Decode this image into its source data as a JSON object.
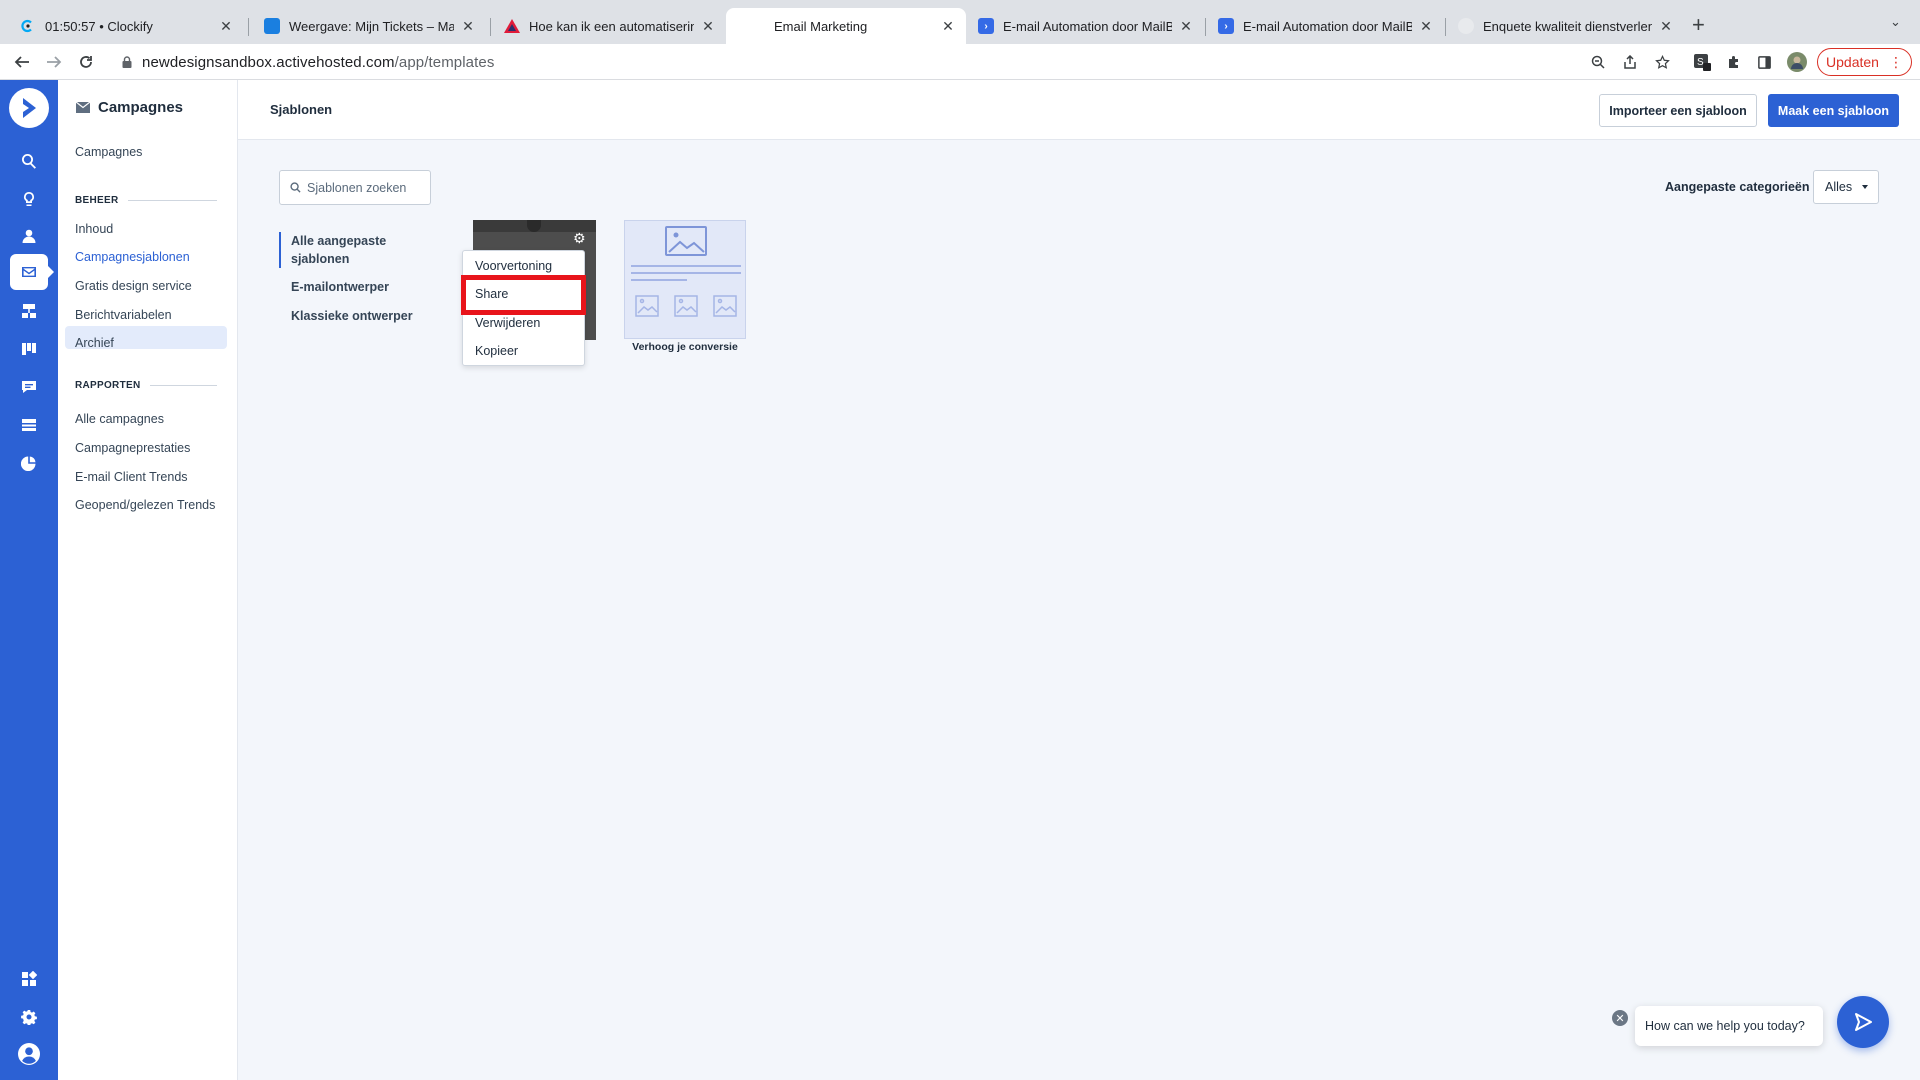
{
  "browser": {
    "tabs": [
      {
        "title": "01:50:57 • Clockify",
        "favicon": "clockify-icon",
        "color": "#03a9f4"
      },
      {
        "title": "Weergave: Mijn Tickets – MailBlue",
        "favicon": "mailblue-icon",
        "color": "#1a7fe0"
      },
      {
        "title": "Hoe kan ik een automatisering",
        "favicon": "triangle-icon",
        "color": "#e01b3a"
      },
      {
        "title": "Email Marketing",
        "favicon": "",
        "color": ""
      },
      {
        "title": "E-mail Automation door MailBlue",
        "favicon": "activecampaign-icon",
        "color": "#356ae6"
      },
      {
        "title": "E-mail Automation door MailBlue",
        "favicon": "activecampaign-icon",
        "color": "#356ae6"
      },
      {
        "title": "Enquete kwaliteit dienstverlening",
        "favicon": "globe-icon",
        "color": "#9aa0a6"
      }
    ],
    "url_host": "newdesignsandbox.activehosted.com",
    "url_path": "/app/templates",
    "update_label": "Updaten"
  },
  "subnav": {
    "title": "Campagnes",
    "top_link": "Campagnes",
    "section_beheer": "BEHEER",
    "beheer_items": [
      "Inhoud",
      "Campagnesjablonen",
      "Gratis design service",
      "Berichtvariabelen",
      "Archief"
    ],
    "section_rapporten": "RAPPORTEN",
    "rapporten_items": [
      "Alle campagnes",
      "Campagneprestaties",
      "E-mail Client Trends",
      "Geopend/gelezen Trends"
    ]
  },
  "header": {
    "title": "Sjablonen",
    "import_label": "Importeer een sjabloon",
    "create_label": "Maak een sjabloon"
  },
  "content": {
    "search_placeholder": "Sjablonen zoeken",
    "category_label": "Aangepaste categorieën",
    "category_value": "Alles",
    "filters": [
      "Alle aangepaste sjablonen",
      "E-mailontwerper",
      "Klassieke ontwerper"
    ],
    "template2_name": "Verhoog je conversie",
    "context_menu": [
      "Voorvertoning",
      "Share",
      "Verwijderen",
      "Kopieer"
    ]
  },
  "help": {
    "prompt": "How can we help you today?"
  },
  "colors": {
    "brand": "#2c61d4",
    "highlight": "#e8141b"
  }
}
